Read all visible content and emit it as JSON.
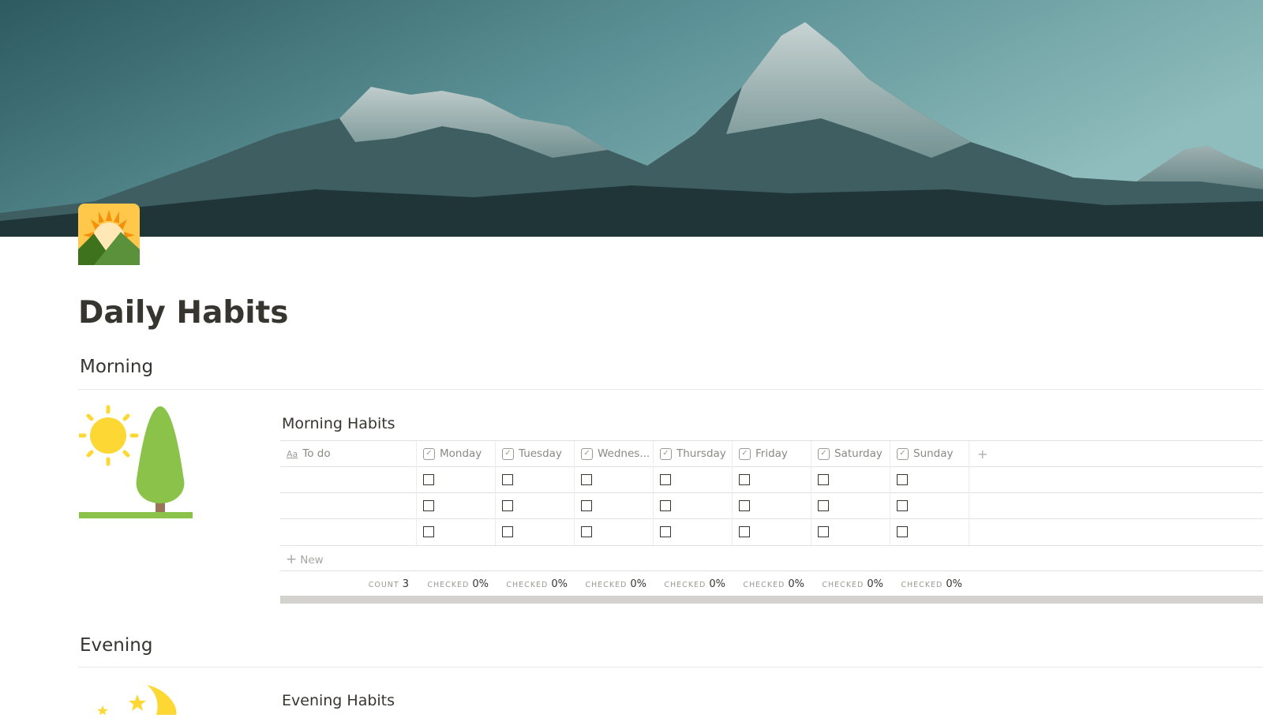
{
  "page": {
    "title": "Daily Habits",
    "icon": "sunrise-over-mountains-icon",
    "cover": "mountain-peaks-cover-image"
  },
  "sections": [
    {
      "heading": "Morning",
      "illustration": "sun-and-tree-icon",
      "database": {
        "title": "Morning Habits",
        "columns": [
          {
            "label": "To do",
            "type": "title",
            "icon": "text-aa-icon"
          },
          {
            "label": "Monday",
            "type": "checkbox",
            "icon": "checkbox-property-icon"
          },
          {
            "label": "Tuesday",
            "type": "checkbox",
            "icon": "checkbox-property-icon"
          },
          {
            "label": "Wednes...",
            "type": "checkbox",
            "icon": "checkbox-property-icon"
          },
          {
            "label": "Thursday",
            "type": "checkbox",
            "icon": "checkbox-property-icon"
          },
          {
            "label": "Friday",
            "type": "checkbox",
            "icon": "checkbox-property-icon"
          },
          {
            "label": "Saturday",
            "type": "checkbox",
            "icon": "checkbox-property-icon"
          },
          {
            "label": "Sunday",
            "type": "checkbox",
            "icon": "checkbox-property-icon"
          }
        ],
        "add_column": "+",
        "rows": [
          {
            "todo": "",
            "checks": [
              false,
              false,
              false,
              false,
              false,
              false,
              false
            ]
          },
          {
            "todo": "",
            "checks": [
              false,
              false,
              false,
              false,
              false,
              false,
              false
            ]
          },
          {
            "todo": "",
            "checks": [
              false,
              false,
              false,
              false,
              false,
              false,
              false
            ]
          }
        ],
        "new_label": "New",
        "footer": [
          {
            "label": "COUNT",
            "value": "3"
          },
          {
            "label": "CHECKED",
            "value": "0%"
          },
          {
            "label": "CHECKED",
            "value": "0%"
          },
          {
            "label": "CHECKED",
            "value": "0%"
          },
          {
            "label": "CHECKED",
            "value": "0%"
          },
          {
            "label": "CHECKED",
            "value": "0%"
          },
          {
            "label": "CHECKED",
            "value": "0%"
          },
          {
            "label": "CHECKED",
            "value": "0%"
          }
        ]
      }
    },
    {
      "heading": "Evening",
      "illustration": "moon-and-stars-icon",
      "database": {
        "title": "Evening Habits"
      }
    }
  ]
}
